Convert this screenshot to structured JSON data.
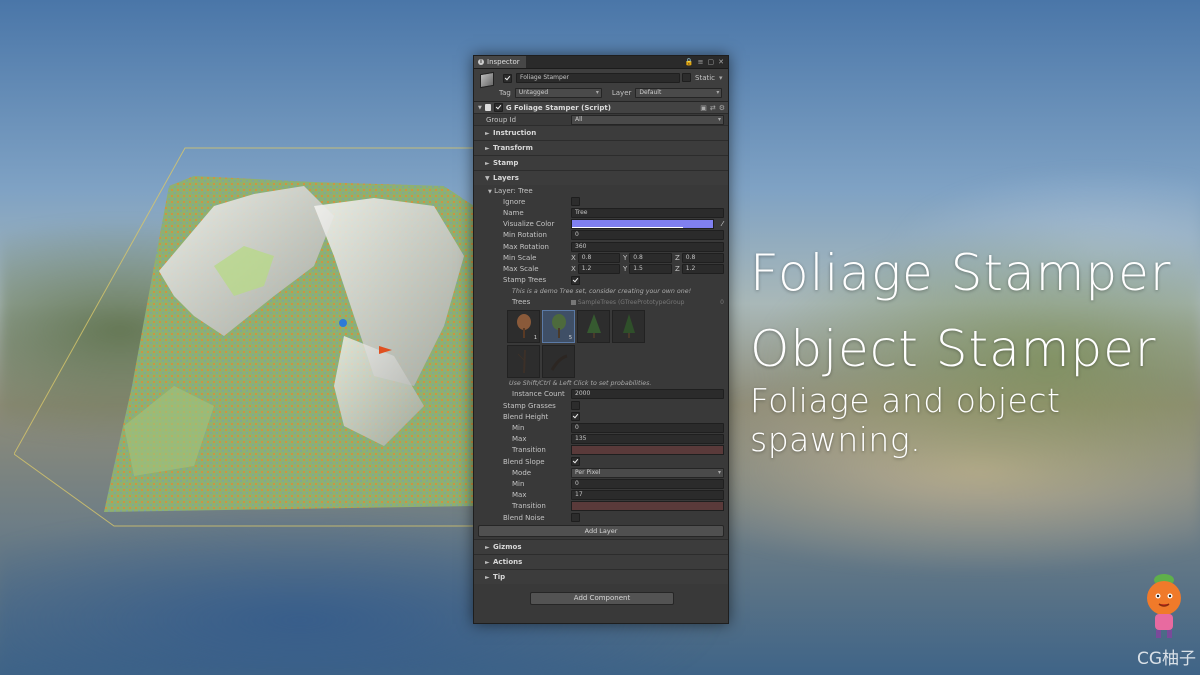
{
  "inspector": {
    "tab_label": "Inspector",
    "object_name": "Foliage Stamper",
    "static_label": "Static",
    "tag_label": "Tag",
    "tag_value": "Untagged",
    "layer_label": "Layer",
    "layer_value": "Default",
    "component_title": "G Foliage Stamper (Script)",
    "group_id_label": "Group Id",
    "group_id_value": "All",
    "sections": {
      "instruction": "Instruction",
      "transform": "Transform",
      "stamp": "Stamp",
      "layers": "Layers",
      "gizmos": "Gizmos",
      "actions": "Actions",
      "tip": "Tip"
    },
    "layer_header": "Layer: Tree",
    "fields": {
      "ignore": "Ignore",
      "name_label": "Name",
      "name_value": "Tree",
      "visualize_color": "Visualize Color",
      "min_rotation_label": "Min Rotation",
      "min_rotation_value": "0",
      "max_rotation_label": "Max Rotation",
      "max_rotation_value": "360",
      "min_scale_label": "Min Scale",
      "min_scale": {
        "x": "0.8",
        "y": "0.8",
        "z": "0.8"
      },
      "max_scale_label": "Max Scale",
      "max_scale": {
        "x": "1.2",
        "y": "1.5",
        "z": "1.2"
      },
      "stamp_trees": "Stamp Trees",
      "demo_help": "This is a demo Tree set, consider creating your own one!",
      "trees_label": "Trees",
      "trees_value": "SampleTrees (GTreePrototypeGroup",
      "trees_suffix": "0",
      "thumb_numbers": [
        "1",
        "5"
      ],
      "probability_help": "Use Shift/Ctrl & Left Click to set probabilities.",
      "instance_count_label": "Instance Count",
      "instance_count_value": "2000",
      "stamp_grasses": "Stamp Grasses",
      "blend_height": "Blend Height",
      "bh_min_label": "Min",
      "bh_min_value": "0",
      "bh_max_label": "Max",
      "bh_max_value": "135",
      "bh_transition": "Transition",
      "blend_slope": "Blend Slope",
      "bs_mode_label": "Mode",
      "bs_mode_value": "Per Pixel",
      "bs_min_label": "Min",
      "bs_min_value": "0",
      "bs_max_label": "Max",
      "bs_max_value": "17",
      "bs_transition": "Transition",
      "blend_noise": "Blend Noise"
    },
    "add_layer": "Add Layer",
    "add_component": "Add Component",
    "axis": {
      "x": "X",
      "y": "Y",
      "z": "Z"
    }
  },
  "overlay": {
    "line1": "Foliage Stamper",
    "line2": "Object Stamper",
    "line3": "Foliage and object spawning."
  },
  "watermark": "CG柚子",
  "colors": {
    "visualize": "#8080f0",
    "panel": "#393939",
    "transition": "#5a3a3a"
  }
}
